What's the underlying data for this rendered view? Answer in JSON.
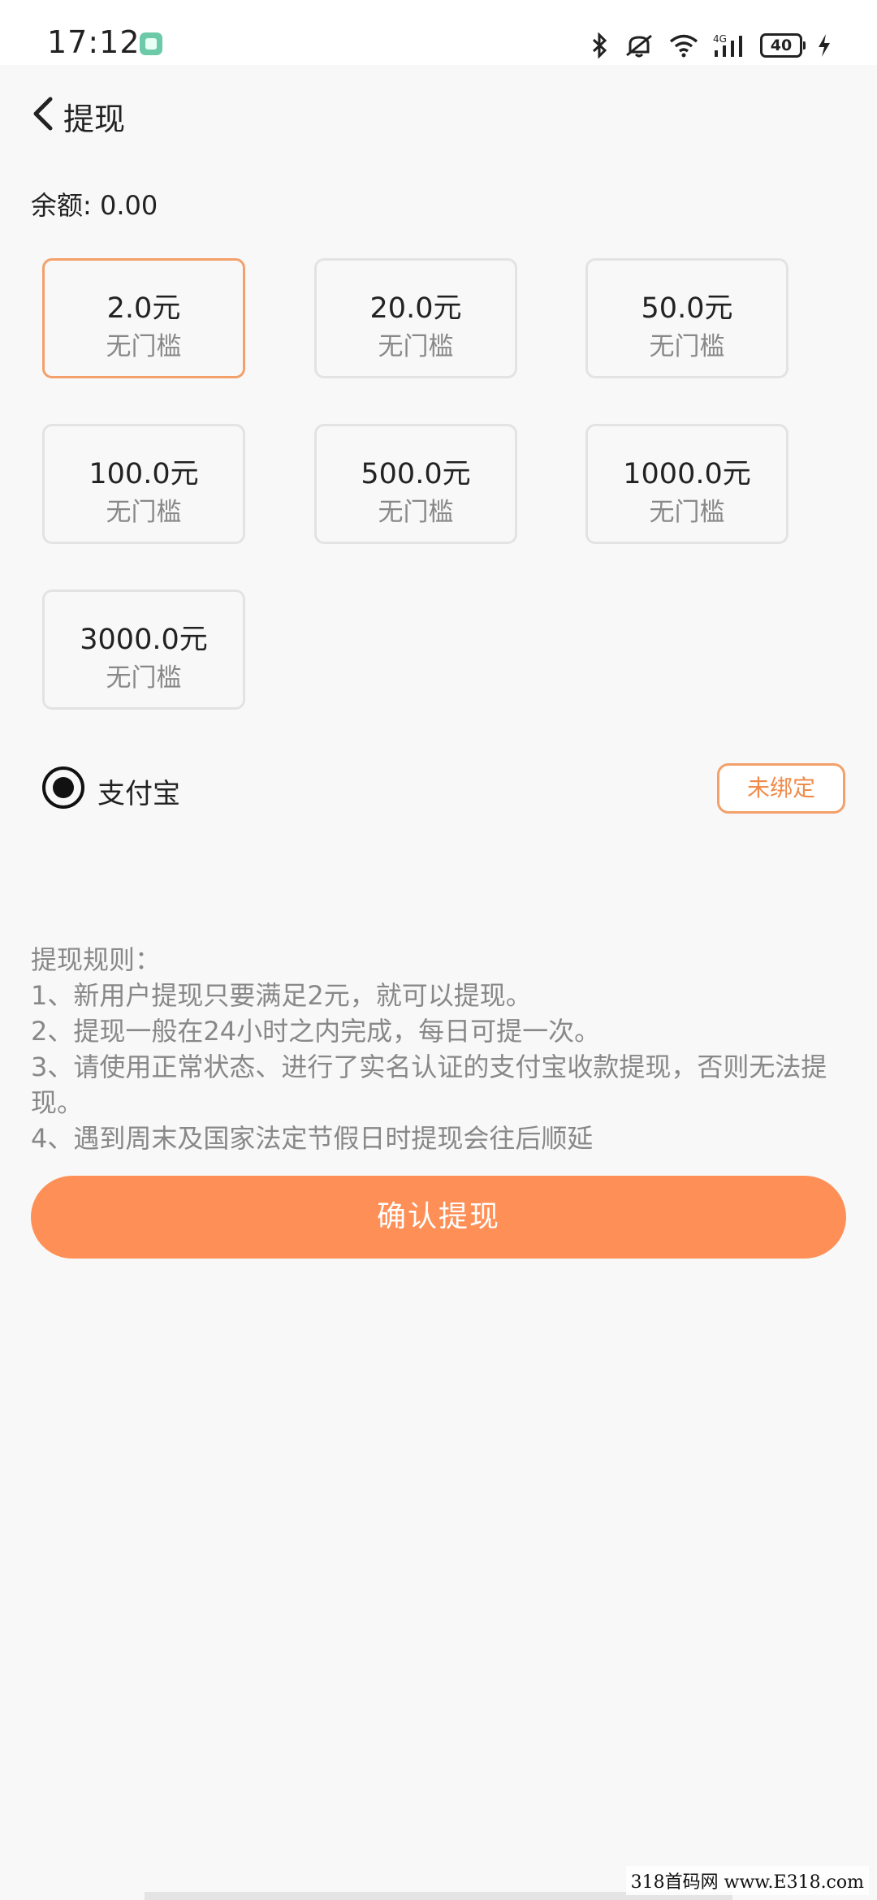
{
  "status_bar": {
    "time": "17:12",
    "network": "4G",
    "battery": "40",
    "icons": [
      "bluetooth-icon",
      "mute-icon",
      "wifi-icon",
      "signal-icon",
      "battery-icon",
      "charging-icon"
    ]
  },
  "header": {
    "back_icon": "chevron-left-icon",
    "title": "提现"
  },
  "balance": {
    "text": "余额: 0.00"
  },
  "amounts": [
    {
      "value": "2.0元",
      "sub": "无门槛",
      "selected": true
    },
    {
      "value": "20.0元",
      "sub": "无门槛",
      "selected": false
    },
    {
      "value": "50.0元",
      "sub": "无门槛",
      "selected": false
    },
    {
      "value": "100.0元",
      "sub": "无门槛",
      "selected": false
    },
    {
      "value": "500.0元",
      "sub": "无门槛",
      "selected": false
    },
    {
      "value": "1000.0元",
      "sub": "无门槛",
      "selected": false
    },
    {
      "value": "3000.0元",
      "sub": "无门槛",
      "selected": false
    }
  ],
  "payment": {
    "method": "支付宝",
    "selected": true,
    "bind_status": "未绑定"
  },
  "rules": {
    "title": "提现规则：",
    "items": [
      "1、新用户提现只要满足2元，就可以提现。",
      "2、提现一般在24小时之内完成，每日可提一次。",
      "3、请使用正常状态、进行了实名认证的支付宝收款提现，否则无法提现。",
      "4、遇到周末及国家法定节假日时提现会往后顺延"
    ]
  },
  "confirm_button": "确认提现",
  "watermark": "318首码网 www.E318.com",
  "colors": {
    "accent": "#fe9057",
    "accent_border": "#f3a06a",
    "background": "#f8f8f8"
  }
}
